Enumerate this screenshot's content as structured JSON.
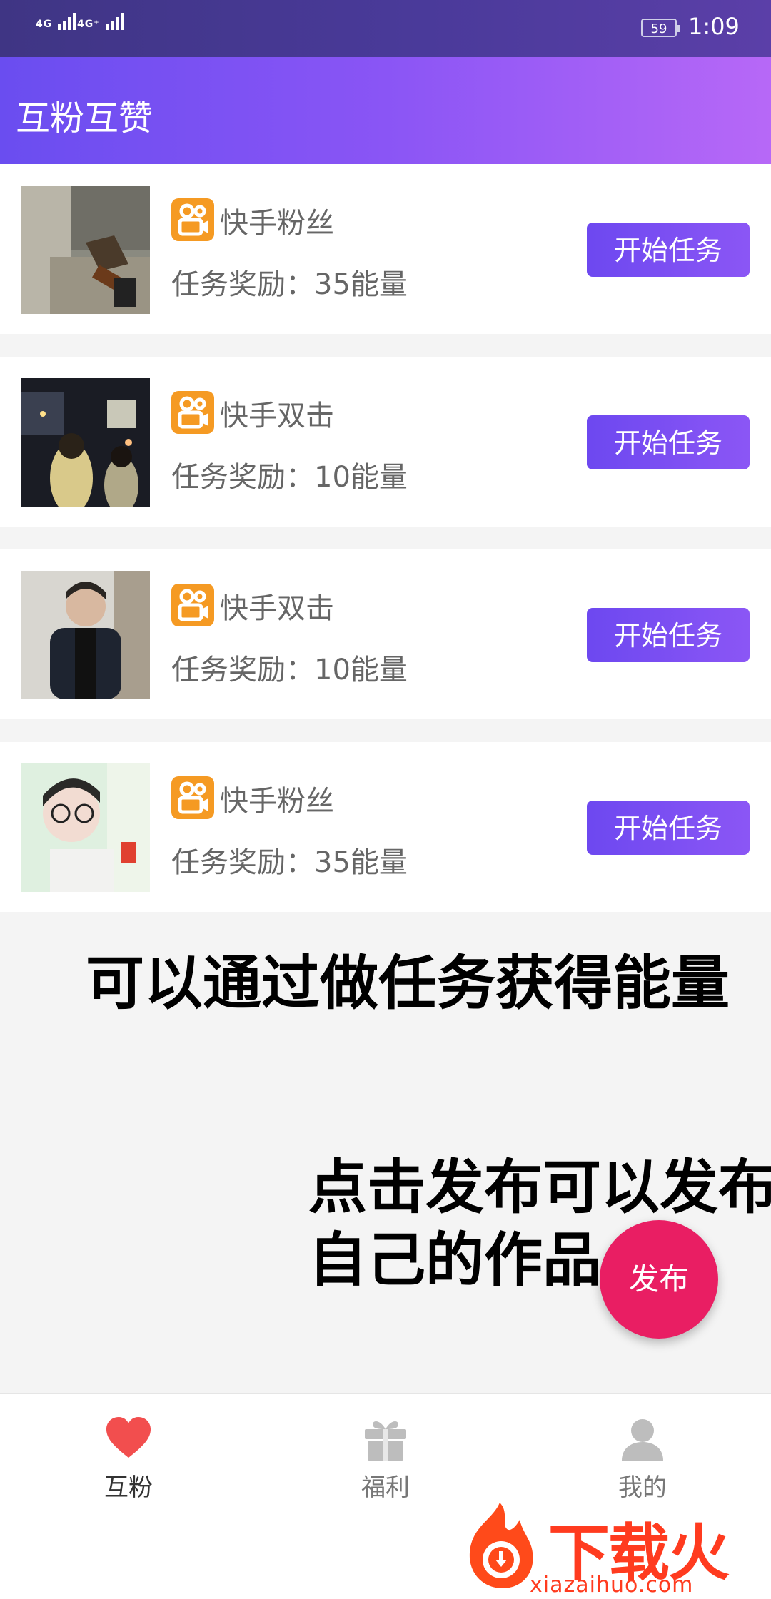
{
  "status_bar": {
    "signal1": "4G",
    "signal2": "4G⁺",
    "battery": "59",
    "time": "1:09"
  },
  "header": {
    "title": "互粉互赞"
  },
  "tasks": [
    {
      "platform": "快手粉丝",
      "reward_label": "任务奖励：",
      "reward_value": "35能量",
      "button": "开始任务"
    },
    {
      "platform": "快手双击",
      "reward_label": "任务奖励：",
      "reward_value": "10能量",
      "button": "开始任务"
    },
    {
      "platform": "快手双击",
      "reward_label": "任务奖励：",
      "reward_value": "10能量",
      "button": "开始任务"
    },
    {
      "platform": "快手粉丝",
      "reward_label": "任务奖励：",
      "reward_value": "35能量",
      "button": "开始任务"
    }
  ],
  "annotations": {
    "line1": "可以通过做任务获得能量",
    "line2": "点击发布可以发布",
    "line3": "自己的作品"
  },
  "fab": {
    "label": "发布"
  },
  "bottom_nav": [
    {
      "label": "互粉",
      "icon": "heart-icon",
      "active": true,
      "color": "#f24e4e"
    },
    {
      "label": "福利",
      "icon": "gift-icon",
      "active": false,
      "color": "#bdbdbd"
    },
    {
      "label": "我的",
      "icon": "user-icon",
      "active": false,
      "color": "#bdbdbd"
    }
  ],
  "watermark": {
    "text": "下载火",
    "url": "xiazaihuo.com"
  },
  "colors": {
    "accent": "#7b52f3",
    "fab": "#e91e63",
    "kuaishou": "#f59a23"
  }
}
